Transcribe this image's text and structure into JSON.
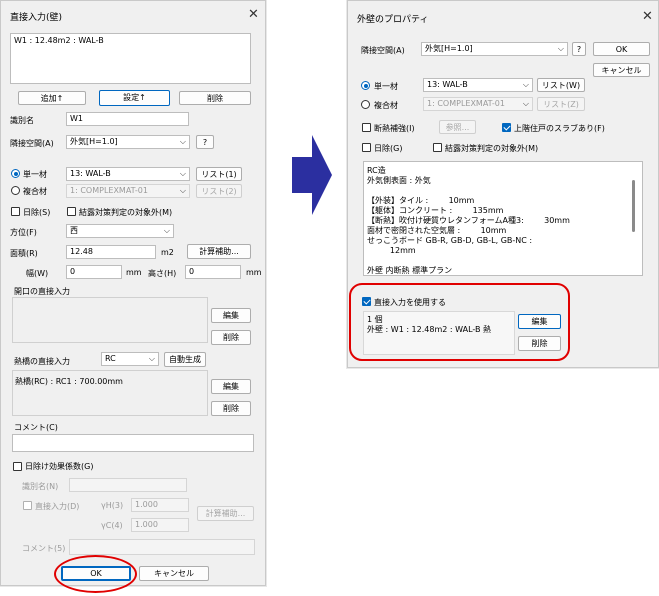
{
  "left": {
    "title": "直接入力(壁)",
    "text_area": "W1 : 12.48m2 : WAL-B",
    "btn_add": "追加↑",
    "btn_set": "設定↑",
    "btn_del": "削除",
    "id_label": "識別名",
    "id_value": "W1",
    "adj_label": "隣接空間(A)",
    "adj_value": "外気[H=1.0]",
    "help": "?",
    "single_label": "単一材",
    "single_value": "13: WAL-B",
    "list1": "リスト(1)",
    "multi_label": "複合材",
    "multi_value": "1: COMPLEXMAT-01",
    "list2": "リスト(2)",
    "shade_label": "日除(S)",
    "exclude_label": "結露対策判定の対象外(M)",
    "dir_label": "方位(F)",
    "dir_value": "西",
    "area_label": "面積(R)",
    "area_value": "12.48",
    "area_unit": "m2",
    "calc_btn": "計算補助...",
    "width_label": "幅(W)",
    "width_value": "0",
    "width_unit": "mm",
    "height_label": "高さ(H)",
    "height_value": "0",
    "height_unit": "mm",
    "opening_label": "開口の直接入力",
    "edit1": "編集",
    "del1": "削除",
    "thermal_label": "熱橋の直接入力",
    "thermal_sel": "RC",
    "autogen": "自動生成",
    "thermal_text": "熱橋(RC) : RC1 : 700.00mm",
    "edit2": "編集",
    "del2": "削除",
    "comment_label": "コメント(C)",
    "shade_eff_label": "日除け効果係数(G)",
    "id2_label": "識別名(N)",
    "direct_label": "直接入力(D)",
    "yh_label": "γH(3)",
    "yh_value": "1.000",
    "calc2": "計算補助...",
    "yc_label": "γC(4)",
    "yc_value": "1.000",
    "comment2_label": "コメント(5)",
    "ok": "OK",
    "cancel": "キャンセル"
  },
  "right": {
    "title": "外壁のプロパティ",
    "adj_label": "隣接空間(A)",
    "adj_value": "外気[H=1.0]",
    "help": "?",
    "ok": "OK",
    "cancel": "キャンセル",
    "single_label": "単一材",
    "single_value": "13: WAL-B",
    "list_w": "リスト(W)",
    "multi_label": "複合材",
    "multi_value": "1: COMPLEXMAT-01",
    "list_z": "リスト(Z)",
    "insul_label": "断熱補強(I)",
    "ref_btn": "参照...",
    "upper_label": "上階住戸のスラブあり(F)",
    "shade_label": "日除(G)",
    "exclude_label": "結露対策判定の対象外(M)",
    "desc_lines": [
      "RC造",
      "外気側表面 : 外気",
      "",
      "【外装】タイル :        10mm",
      "【躯体】コンクリート :        135mm",
      "【断熱】吹付け硬質ウレタンフォームA種3:        30mm",
      "面材で密閉された空気層 :        10mm",
      "せっこうボード GB-R, GB-D, GB-L, GB-NC :",
      "         12mm",
      "",
      "外壁 内断熱 標準プラン"
    ],
    "direct_check_label": "直接入力を使用する",
    "direct_text": [
      "1 個",
      "外壁 : W1 : 12.48m2 : WAL-B 熱"
    ],
    "edit": "編集",
    "del": "削除"
  },
  "colors": {
    "accent": "#0067c0",
    "annotation": "#e00000",
    "arrow": "#2b2fa0"
  }
}
